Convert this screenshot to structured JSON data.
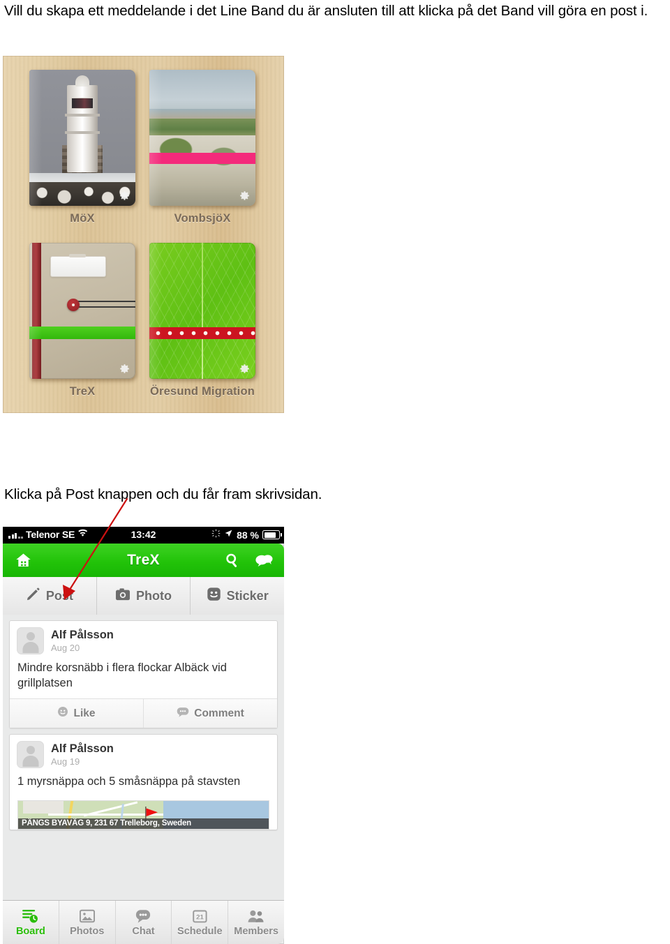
{
  "document": {
    "intro_paragraph": "Vill du skapa ett meddelande i det Line Band du är ansluten till att klicka på det Band vill göra en post i.",
    "caption": "Klicka på Post knappen och du får fram skrivsidan."
  },
  "band_list": {
    "bands": [
      {
        "name": "MöX",
        "gear_icon": "gear-icon"
      },
      {
        "name": "VombsjöX",
        "gear_icon": "gear-icon"
      },
      {
        "name": "TreX",
        "gear_icon": "gear-icon"
      },
      {
        "name": "Öresund Migration",
        "gear_icon": "gear-icon"
      }
    ]
  },
  "phone": {
    "status_bar": {
      "carrier": "Telenor SE",
      "time": "13:42",
      "battery_percent": "88 %",
      "signal_icon": "signal-bars-icon",
      "wifi_icon": "wifi-icon",
      "activity_icon": "spinner-icon",
      "location_icon": "location-arrow-icon",
      "battery_icon": "battery-icon"
    },
    "nav_bar": {
      "title": "TreX",
      "home_icon": "home-icon",
      "search_icon": "search-icon",
      "chat_icon": "chat-bubbles-icon",
      "accent_color": "#22c309"
    },
    "compose_row": [
      {
        "label": "Post",
        "icon": "pencil-icon"
      },
      {
        "label": "Photo",
        "icon": "camera-icon"
      },
      {
        "label": "Sticker",
        "icon": "smiley-icon"
      }
    ],
    "feed": [
      {
        "author": "Alf Pålsson",
        "date": "Aug 20",
        "text": "Mindre korsnäbb i flera flockar Albäck vid grillplatsen",
        "actions": [
          {
            "label": "Like",
            "icon": "smiley-icon"
          },
          {
            "label": "Comment",
            "icon": "comment-bubble-icon"
          }
        ]
      },
      {
        "author": "Alf Pålsson",
        "date": "Aug 19",
        "text": "1 myrsnäppa och 5 småsnäppa på stavsten",
        "map_address": "PÄNGS BYAVÄG 9, 231 67 Trelleborg, Sweden",
        "map_marker_icon": "red-flag-icon"
      }
    ],
    "tab_bar": [
      {
        "label": "Board",
        "icon": "board-icon",
        "active": true
      },
      {
        "label": "Photos",
        "icon": "photo-icon",
        "active": false
      },
      {
        "label": "Chat",
        "icon": "chat-icon",
        "active": false
      },
      {
        "label": "Schedule",
        "icon": "calendar-icon",
        "badge": "21",
        "active": false
      },
      {
        "label": "Members",
        "icon": "members-icon",
        "active": false
      }
    ]
  },
  "annotation": {
    "arrow_color": "#cc1111",
    "points_to": "Post"
  }
}
